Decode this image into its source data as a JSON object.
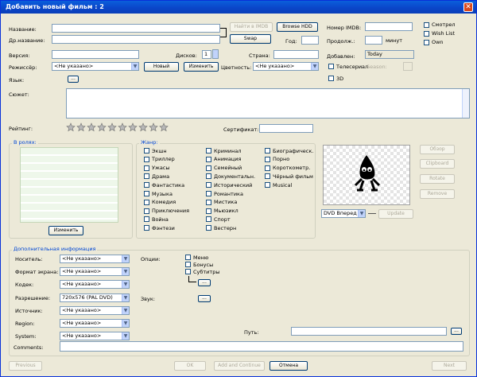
{
  "window": {
    "title": "Добавить новый фильм : 2",
    "close": "✕"
  },
  "labels": {
    "title": "Название:",
    "orig_title": "Др.название:",
    "version": "Версия:",
    "director": "Режиссёр:",
    "lang": "Язык:",
    "plot": "Сюжет:",
    "rating": "Рейтинг:",
    "cert": "Сертификат:",
    "imdb_no": "Номер IMDB:",
    "year": "Год:",
    "duration": "Продолж.:",
    "minutes": "минут",
    "discs": "Дисков:",
    "country": "Страна:",
    "added": "Добавлен:",
    "color": "Цветность:",
    "tvseries": "Телесериал",
    "season": "Season:",
    "three_d": "3D"
  },
  "values": {
    "title": "",
    "added": "Today",
    "discs": "1",
    "director": "<Не указано>",
    "color": "<Не указано>"
  },
  "top_checks": [
    "Смотрел",
    "Wish List",
    "Own"
  ],
  "buttons": {
    "imdb": "Найти в IMDB",
    "browse": "Browse HDD",
    "swap": "Swap",
    "new": "Новый",
    "change": "Изменить",
    "lang_more": "...",
    "roles_change": "Изменить",
    "browse_img": "Обзор",
    "clipboard": "Clipboard",
    "rotate": "Rotate",
    "remove": "Remove",
    "update": "Update",
    "dots": "...",
    "previous": "Previous",
    "ok": "OK",
    "add_continue": "Add and Continue",
    "cancel": "Отмена",
    "next": "Next"
  },
  "roles": {
    "title": "В ролях:"
  },
  "genres": {
    "title": "Жанр:",
    "col1": [
      "Экшн",
      "Триллер",
      "Ужасы",
      "Драма",
      "Фантастика",
      "Музыка",
      "Комедия",
      "Приключения",
      "Война",
      "Фэнтези"
    ],
    "col2": [
      "Криминал",
      "Анимация",
      "Семейный",
      "Документальн.",
      "Исторический",
      "Романтика",
      "Мистика",
      "Мьюзикл",
      "Спорт",
      "Вестерн"
    ],
    "col3": [
      "Биографическ.",
      "Порно",
      "Короткометр.",
      "Чёрный фильм",
      "Musical"
    ]
  },
  "image": {
    "source": "DVD Вперед"
  },
  "extra": {
    "title": "Дополнительная информация",
    "fields": [
      {
        "label": "Носитель:",
        "value": "<Не указано>"
      },
      {
        "label": "Формат экрана:",
        "value": "<Не указано>"
      },
      {
        "label": "Кодек:",
        "value": "<Не указано>"
      },
      {
        "label": "Разрешение:",
        "value": "720x576 (PAL DVD)"
      },
      {
        "label": "Источник:",
        "value": "<Не указано>"
      },
      {
        "label": "Region:",
        "value": "<Не указано>"
      },
      {
        "label": "System:",
        "value": "<Не указано>"
      }
    ],
    "options_label": "Опции:",
    "options": [
      "Меню",
      "Бонусы",
      "Субтитры"
    ],
    "sound_label": "Звук:",
    "path_label": "Путь:",
    "comments_label": "Comments:"
  },
  "icons": {
    "dropdown": "chevron-down-icon",
    "star": "star-icon",
    "close": "close-icon"
  }
}
